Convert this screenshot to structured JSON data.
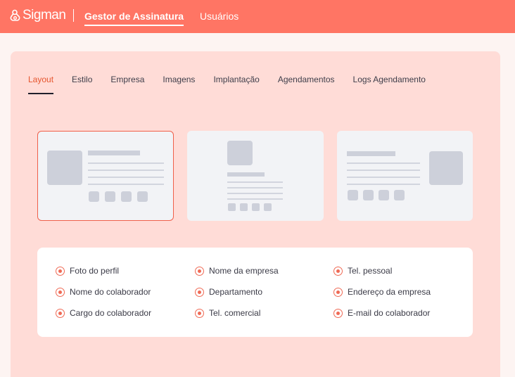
{
  "app": {
    "name": "Sigman"
  },
  "nav": [
    {
      "label": "Gestor de Assinatura",
      "active": true
    },
    {
      "label": "Usuários",
      "active": false
    }
  ],
  "tabs": [
    {
      "label": "Layout",
      "active": true
    },
    {
      "label": "Estilo",
      "active": false
    },
    {
      "label": "Empresa",
      "active": false
    },
    {
      "label": "Imagens",
      "active": false
    },
    {
      "label": "Implantação",
      "active": false
    },
    {
      "label": "Agendamentos",
      "active": false
    },
    {
      "label": "Logs Agendamento",
      "active": false
    }
  ],
  "layouts": [
    {
      "variant": "image-left",
      "selected": true
    },
    {
      "variant": "image-top",
      "selected": false
    },
    {
      "variant": "image-right",
      "selected": false
    }
  ],
  "fields": {
    "col1": [
      "Foto do perfil",
      "Nome do colaborador",
      "Cargo do colaborador"
    ],
    "col2": [
      "Nome da empresa",
      "Departamento",
      "Tel. comercial"
    ],
    "col3": [
      "Tel. pessoal",
      "Endereço da empresa",
      "E-mail do colaborador"
    ]
  },
  "colors": {
    "topbar": "#ff7564",
    "panel": "#ffdcd7",
    "accent": "#ef6a55"
  }
}
